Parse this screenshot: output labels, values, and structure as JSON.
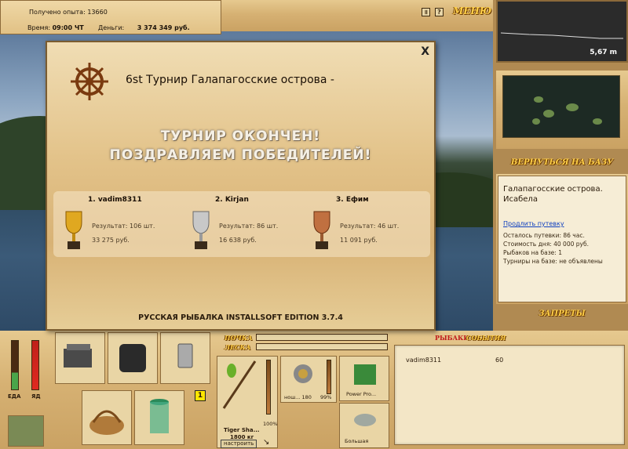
{
  "stats": {
    "experience_label": "Получено опыта:",
    "experience_value": "13660",
    "time_label": "Время:",
    "time_value": "09:00 ЧТ",
    "money_label": "Деньги:",
    "money_value": "3 374 349 руб."
  },
  "topbar": {
    "pause_icon": "pause-icon",
    "help_label": "?",
    "menu_label": "МЕНЮ"
  },
  "depth": {
    "value": "5,67 m"
  },
  "nav": {
    "back_to_base": "ВЕРНУТЬСЯ НА БАЗУ",
    "restrictions": "ЗАПРЕТЫ"
  },
  "location": {
    "title": "Галапагосские острова. Исабела",
    "extend_link": "Продлить путевку",
    "remaining": "Осталось путевки: 86 час.",
    "day_cost": "Стоимость дня: 40 000 руб.",
    "fishers": "Рыбаков на базе: 1",
    "tournaments": "Турниры на базе: не объявлены"
  },
  "modal": {
    "close_label": "X",
    "title": "6st Турнир Галапагосские острова -",
    "headline_1": "ТУРНИР ОКОНЧЕН!",
    "headline_2": "ПОЗДРАВЛЯЕМ ПОБЕДИТЕЛЕЙ!",
    "winners": [
      {
        "name": "1. vadim8311",
        "result": "Результат: 106 шт.",
        "money": "33 275 руб.",
        "cup": "gold-cup-icon"
      },
      {
        "name": "2. Kirjan",
        "result": "Результат: 86 шт.",
        "money": "16 638 руб.",
        "cup": "silver-cup-icon"
      },
      {
        "name": "3. Ефим",
        "result": "Результат: 46 шт.",
        "money": "11 091 руб.",
        "cup": "bronze-cup-icon"
      }
    ],
    "footer": "РУССКАЯ РЫБАЛКА INSTALLSOFT EDITION 3.7.4"
  },
  "meters": {
    "food_label": "ЕДА",
    "poison_label": "ЯД"
  },
  "inventory": {
    "badge": "1",
    "float_label": "ПОЧКА",
    "line_label": "ЛЕСКА",
    "rod_name": "Tiger Sha...",
    "rod_weight": "1800 кг",
    "rod_percent": "100%",
    "setup_button": "настроить",
    "reel_name": "нош... 180",
    "reel_percent": "99%",
    "bait_name": "Power Pro...",
    "lure_name": "Большая"
  },
  "events": {
    "tab_fishers": "РЫБАКИ",
    "tab_events": "СОБЫТИЯ",
    "rows": [
      {
        "player": "vadim8311",
        "score": "60"
      }
    ]
  }
}
